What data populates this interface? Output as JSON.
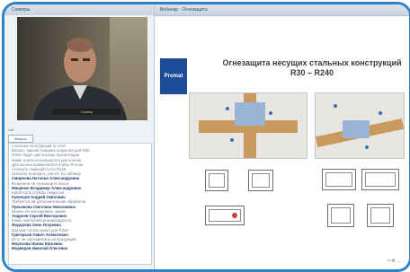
{
  "left_panel": {
    "header": "Спикеры",
    "video": {
      "caption": "Спикер"
    },
    "chat_header": "Чат",
    "chat_tab": "Вопрос",
    "messages": [
      {
        "author": "",
        "text": "стальных конструкций от огня"
      },
      {
        "author": "",
        "text": "Вопрос: какова толщина покрытия для R60"
      },
      {
        "author": "",
        "text": "Ответ будет дан в конце презентации"
      },
      {
        "author": "",
        "text": "Какие плиты используются для колонн"
      },
      {
        "author": "",
        "text": "Для колонн применяются плиты Promat"
      },
      {
        "author": "",
        "text": "Уточните пожалуйста по R120"
      },
      {
        "author": "",
        "text": "Спасибо за вопрос, расчет по таблице"
      },
      {
        "author": "Смирнова Наталья Александровна",
        "text": ""
      },
      {
        "author": "",
        "text": "Возможна ли огнезащита балок"
      },
      {
        "author": "Мищенко Владимир Александрович",
        "text": ""
      },
      {
        "author": "",
        "text": "Какой срок службы покрытия"
      },
      {
        "author": "Кузнецов Андрей Павлович",
        "text": ""
      },
      {
        "author": "",
        "text": "Требуется ли дополнительная обработка"
      },
      {
        "author": "Лукьянова Светлана Николаевна",
        "text": ""
      },
      {
        "author": "",
        "text": "Можно ли монтировать зимой"
      },
      {
        "author": "Андреев Сергей Викторович",
        "text": ""
      },
      {
        "author": "",
        "text": "Какие крепления рекомендуются"
      },
      {
        "author": "Федорова Анна Игоревна",
        "text": ""
      },
      {
        "author": "",
        "text": "Сколько слоев нужно для R240"
      },
      {
        "author": "Григорьев Павел Алексеевич",
        "text": ""
      },
      {
        "author": "",
        "text": "Есть ли сертификаты на продукцию"
      },
      {
        "author": "Морозова Ирина Юрьевна",
        "text": ""
      },
      {
        "author": "Медведев Николай Олегович",
        "text": ""
      }
    ]
  },
  "right_panel": {
    "header": "Вебинар · Огнезащита",
    "logo_text": "Promat",
    "slide_title": "Огнезащита несущих стальных конструкций R30 – R240",
    "footer_tag": "< 4/ ..."
  }
}
